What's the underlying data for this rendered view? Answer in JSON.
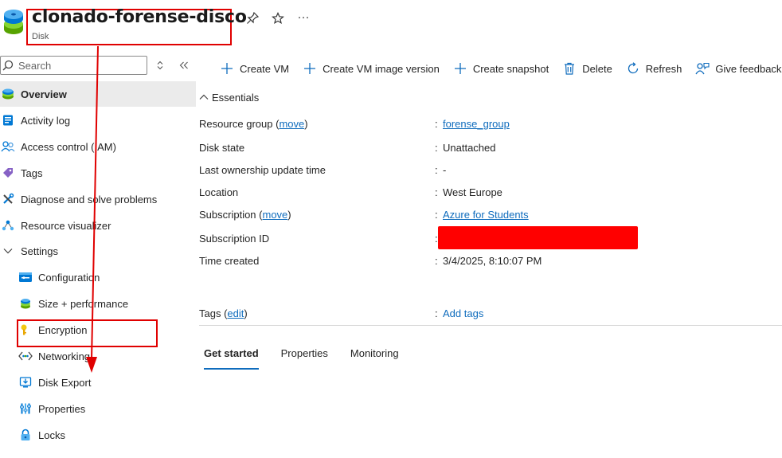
{
  "header": {
    "title": "clonado-forense-disco",
    "subtitle": "Disk",
    "icons": [
      "pin-icon",
      "star-icon",
      "more-icon"
    ],
    "more_glyph": "···"
  },
  "sidebar": {
    "search_placeholder": "Search",
    "items": [
      {
        "label": "Overview",
        "icon": "overview-disk-icon",
        "active": true
      },
      {
        "label": "Activity log",
        "icon": "activity-log-icon"
      },
      {
        "label": "Access control (IAM)",
        "icon": "people-icon"
      },
      {
        "label": "Tags",
        "icon": "tag-icon"
      },
      {
        "label": "Diagnose and solve problems",
        "icon": "wrench-icon"
      },
      {
        "label": "Resource visualizer",
        "icon": "visualizer-icon"
      },
      {
        "label": "Settings",
        "icon": "chevron-down-icon"
      },
      {
        "label": "Configuration",
        "icon": "configuration-icon"
      },
      {
        "label": "Size + performance",
        "icon": "disk-size-icon"
      },
      {
        "label": "Encryption",
        "icon": "key-icon"
      },
      {
        "label": "Networking",
        "icon": "networking-icon"
      },
      {
        "label": "Disk Export",
        "icon": "disk-export-icon"
      },
      {
        "label": "Properties",
        "icon": "properties-icon"
      },
      {
        "label": "Locks",
        "icon": "lock-icon"
      }
    ]
  },
  "toolbar": {
    "create_vm": "Create VM",
    "create_vm_image_version": "Create VM image version",
    "create_snapshot": "Create snapshot",
    "delete": "Delete",
    "refresh": "Refresh",
    "give_feedback": "Give feedback"
  },
  "essentials": {
    "heading": "Essentials",
    "colon": ":",
    "resource_group_label": "Resource group (",
    "move_link": "move",
    "close_paren": ")",
    "resource_group_value": "forense_group",
    "disk_state_label": "Disk state",
    "disk_state_value": "Unattached",
    "ownership_label": "Last ownership update time",
    "ownership_value": "-",
    "location_label": "Location",
    "location_value": "West Europe",
    "subscription_label": "Subscription (",
    "subscription_value": "Azure for Students",
    "subscription_id_label": "Subscription ID",
    "time_created_label": "Time created",
    "time_created_value": "3/4/2025, 8:10:07 PM",
    "tags_label": "Tags (",
    "edit_link": "edit",
    "add_tags": "Add tags"
  },
  "tabs": [
    "Get started",
    "Properties",
    "Monitoring"
  ],
  "colors": {
    "accent": "#0f6cbd",
    "annotation_red": "#e00000",
    "redaction": "#ff0000"
  }
}
